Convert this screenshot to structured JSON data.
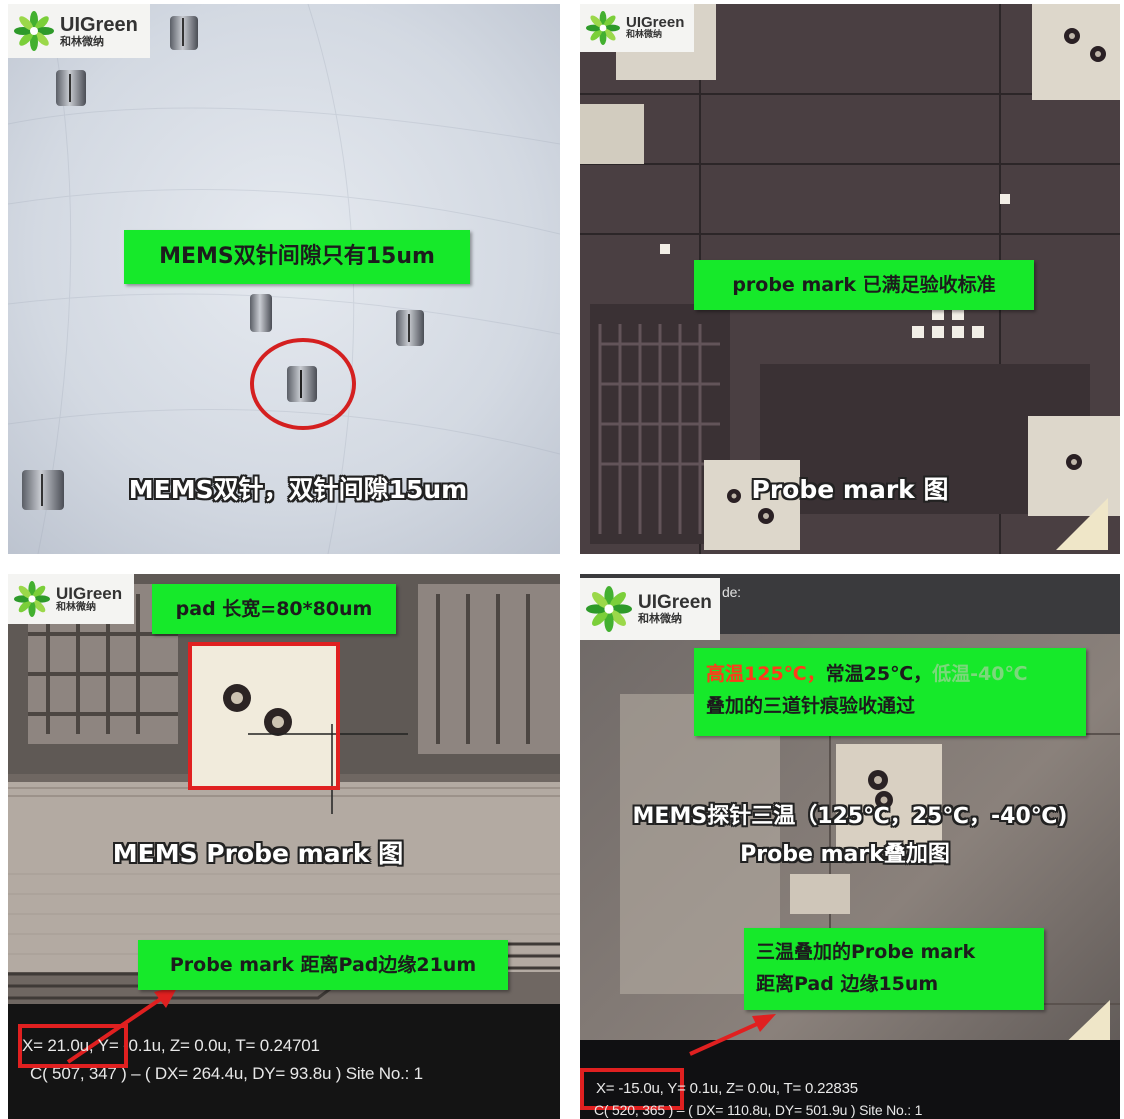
{
  "logo": {
    "brand": "UIGreen",
    "brand_cn": "和林微纳"
  },
  "panels": {
    "top_left": {
      "callout": "MEMS双针间隙只有15um",
      "caption": "MEMS双针，双针间隙15um"
    },
    "top_right": {
      "callout": "probe mark 已满足验收标准",
      "caption": "Probe mark 图"
    },
    "bottom_left": {
      "callout_top": "pad 长宽=80*80um",
      "caption": "MEMS Probe mark 图",
      "callout_bottom": "Probe mark 距离Pad边缘21um",
      "readout_line1_x": "X=  21.0u,",
      "readout_line1_rest": " Y=  -0.1u, Z=   0.0u, T= 0.24701",
      "readout_line2": "C( 507, 347 ) – ( DX=  264.4u, DY=  93.8u ) Site No.:  1"
    },
    "bottom_right": {
      "callout_line1_hot": "高温125℃，",
      "callout_line1_room": "常温25℃，",
      "callout_line1_cold": "低温-40℃",
      "callout_line2": "叠加的三道针痕验收通过",
      "caption_line1": "MEMS探针三温（125℃，25℃，-40℃)",
      "caption_line2": "Probe mark叠加图",
      "callout_bottom_line1": "三温叠加的Probe mark",
      "callout_bottom_line2": "距离Pad 边缘15um",
      "readout_line1_x": "X= -15.0u,",
      "readout_line1_rest": " Y=   0.1u, Z=   0.0u, T= 0.22835",
      "readout_line2": "C( 520, 365 ) – ( DX=  110.8u, DY=  501.9u ) Site No.:  1",
      "corner_text": "de:"
    }
  },
  "colors": {
    "callout_green": "#16e92a",
    "marker_red": "#e02020",
    "hot_text": "#ff3b1a",
    "cold_text": "#7bd87b"
  }
}
